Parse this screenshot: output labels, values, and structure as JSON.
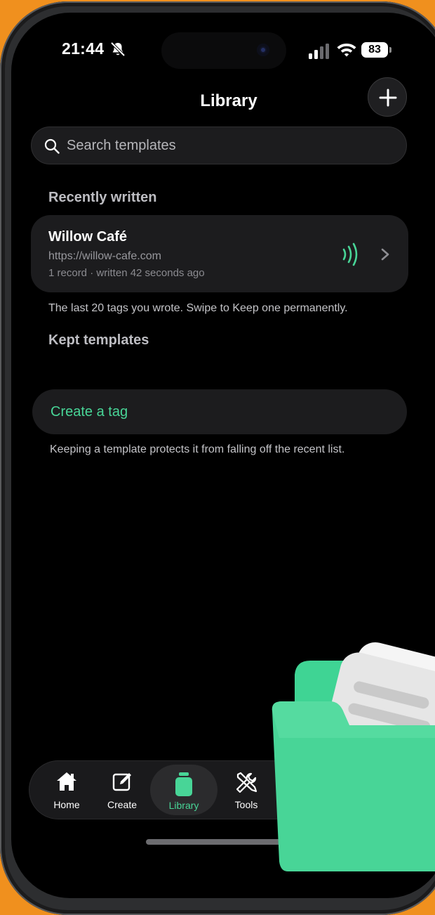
{
  "status": {
    "time": "21:44",
    "battery": "83"
  },
  "header": {
    "title": "Library"
  },
  "search": {
    "placeholder": "Search templates"
  },
  "recent": {
    "heading": "Recently written",
    "item": {
      "name": "Willow Café",
      "url": "https://willow-cafe.com",
      "meta": "1 record · written 42 seconds ago"
    },
    "hint": "The last 20 tags you wrote. Swipe to Keep one permanently."
  },
  "kept": {
    "heading": "Kept templates",
    "create_label": "Create a tag",
    "hint": "Keeping a template protects it from falling off the recent list."
  },
  "tabs": [
    {
      "label": "Home",
      "icon": "home-icon"
    },
    {
      "label": "Create",
      "icon": "edit-icon"
    },
    {
      "label": "Library",
      "icon": "library-icon",
      "active": true
    },
    {
      "label": "Tools",
      "icon": "tools-icon"
    }
  ],
  "colors": {
    "accent": "#48d597",
    "background": "#000000",
    "card": "#1c1c1e",
    "frame": "#f0901e"
  }
}
